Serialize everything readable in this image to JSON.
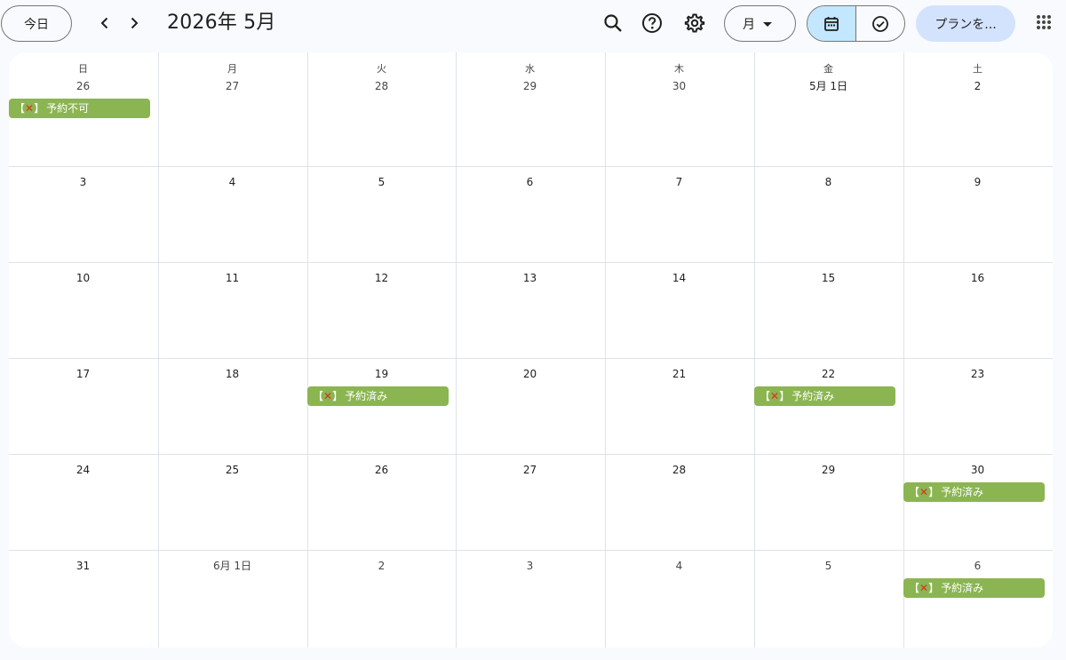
{
  "header": {
    "today_label": "今日",
    "title": "2026年 5月",
    "view_label": "月",
    "plan_label": "プランを..."
  },
  "weekdays": [
    "日",
    "月",
    "火",
    "水",
    "木",
    "金",
    "土"
  ],
  "weeks": [
    [
      "26",
      "27",
      "28",
      "29",
      "30",
      "5月 1日",
      "2"
    ],
    [
      "3",
      "4",
      "5",
      "6",
      "7",
      "8",
      "9"
    ],
    [
      "10",
      "11",
      "12",
      "13",
      "14",
      "15",
      "16"
    ],
    [
      "17",
      "18",
      "19",
      "20",
      "21",
      "22",
      "23"
    ],
    [
      "24",
      "25",
      "26",
      "27",
      "28",
      "29",
      "30"
    ],
    [
      "31",
      "6月 1日",
      "2",
      "3",
      "4",
      "5",
      "6"
    ]
  ],
  "events": {
    "w0_d0": {
      "bracket_open": "【",
      "mark": "✕",
      "bracket_close": "】",
      "text": "予約不可"
    },
    "w3_d2": {
      "bracket_open": "【",
      "mark": "✕",
      "bracket_close": "】",
      "text": "予約済み"
    },
    "w3_d5": {
      "bracket_open": "【",
      "mark": "✕",
      "bracket_close": "】",
      "text": "予約済み"
    },
    "w4_d6": {
      "bracket_open": "【",
      "mark": "✕",
      "bracket_close": "】",
      "text": "予約済み"
    },
    "w5_d6": {
      "bracket_open": "【",
      "mark": "✕",
      "bracket_close": "】",
      "text": "予約済み"
    }
  },
  "colors": {
    "event_bg": "#8bb550",
    "accent_selected": "#c2e7ff",
    "plan_button": "#d3e3fd",
    "cross_mark": "#d93025"
  },
  "icons": [
    "chevron-left-icon",
    "chevron-right-icon",
    "search-icon",
    "help-icon",
    "gear-icon",
    "caret-down-icon",
    "calendar-icon",
    "task-check-icon",
    "apps-grid-icon"
  ]
}
